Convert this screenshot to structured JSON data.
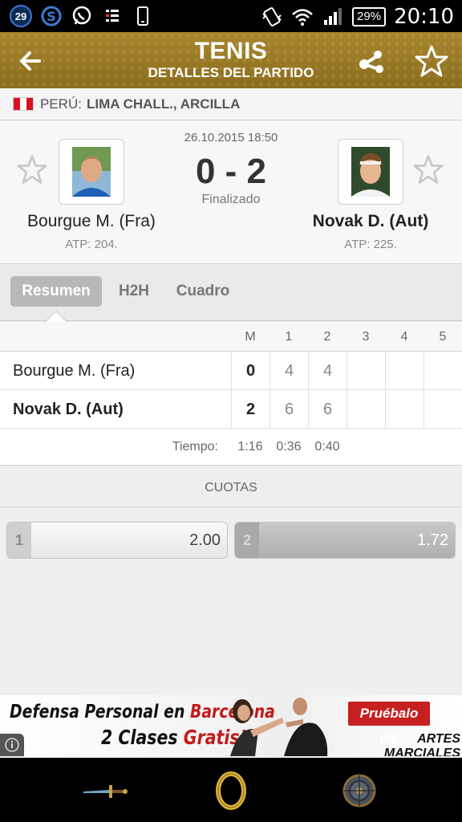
{
  "status_bar": {
    "notification_count": "29",
    "icons_left": [
      "notification-badge-icon",
      "s-app-icon",
      "whatsapp-icon",
      "calendar-list-icon",
      "phone-icon"
    ],
    "icons_right": [
      "vibrate-icon",
      "wifi-icon",
      "signal-icon"
    ],
    "battery": "29%",
    "time": "20:10"
  },
  "header": {
    "title": "TENIS",
    "subtitle": "DETALLES DEL PARTIDO",
    "accent_color": "#9c7d26"
  },
  "tournament": {
    "country": "PERÚ:",
    "name": "LIMA CHALL., ARCILLA",
    "flag_colors": [
      "#d91023",
      "#ffffff",
      "#d91023"
    ]
  },
  "match": {
    "datetime": "26.10.2015 18:50",
    "score": "0 - 2",
    "status": "Finalizado",
    "home": {
      "name": "Bourgue M. (Fra)",
      "rank": "ATP: 204."
    },
    "away": {
      "name": "Novak D. (Aut)",
      "rank": "ATP: 225."
    }
  },
  "tabs": [
    {
      "label": "Resumen",
      "active": true
    },
    {
      "label": "H2H",
      "active": false
    },
    {
      "label": "Cuadro",
      "active": false
    }
  ],
  "score_table": {
    "headers": [
      "M",
      "1",
      "2",
      "3",
      "4",
      "5"
    ],
    "rows": [
      {
        "name": "Bourgue M. (Fra)",
        "m": "0",
        "sets": [
          "4",
          "4",
          "",
          "",
          ""
        ]
      },
      {
        "name": "Novak D. (Aut)",
        "m": "2",
        "sets": [
          "6",
          "6",
          "",
          "",
          ""
        ]
      }
    ],
    "time_label": "Tiempo:",
    "times": [
      "1:16",
      "0:36",
      "0:40"
    ]
  },
  "odds": {
    "title": "CUOTAS",
    "items": [
      {
        "num": "1",
        "value": "2.00"
      },
      {
        "num": "2",
        "value": "1.72"
      }
    ]
  },
  "ad": {
    "line1_a": "Defensa Personal en ",
    "line1_b": "Barcelona",
    "line2_a": "2 Clases ",
    "line2_b": "Gratis!",
    "cta": "Pruébalo ya!",
    "brand": "ARTES MARCIALES"
  },
  "bottom_nav": [
    "sword-icon",
    "ring-icon",
    "shield-icon"
  ]
}
